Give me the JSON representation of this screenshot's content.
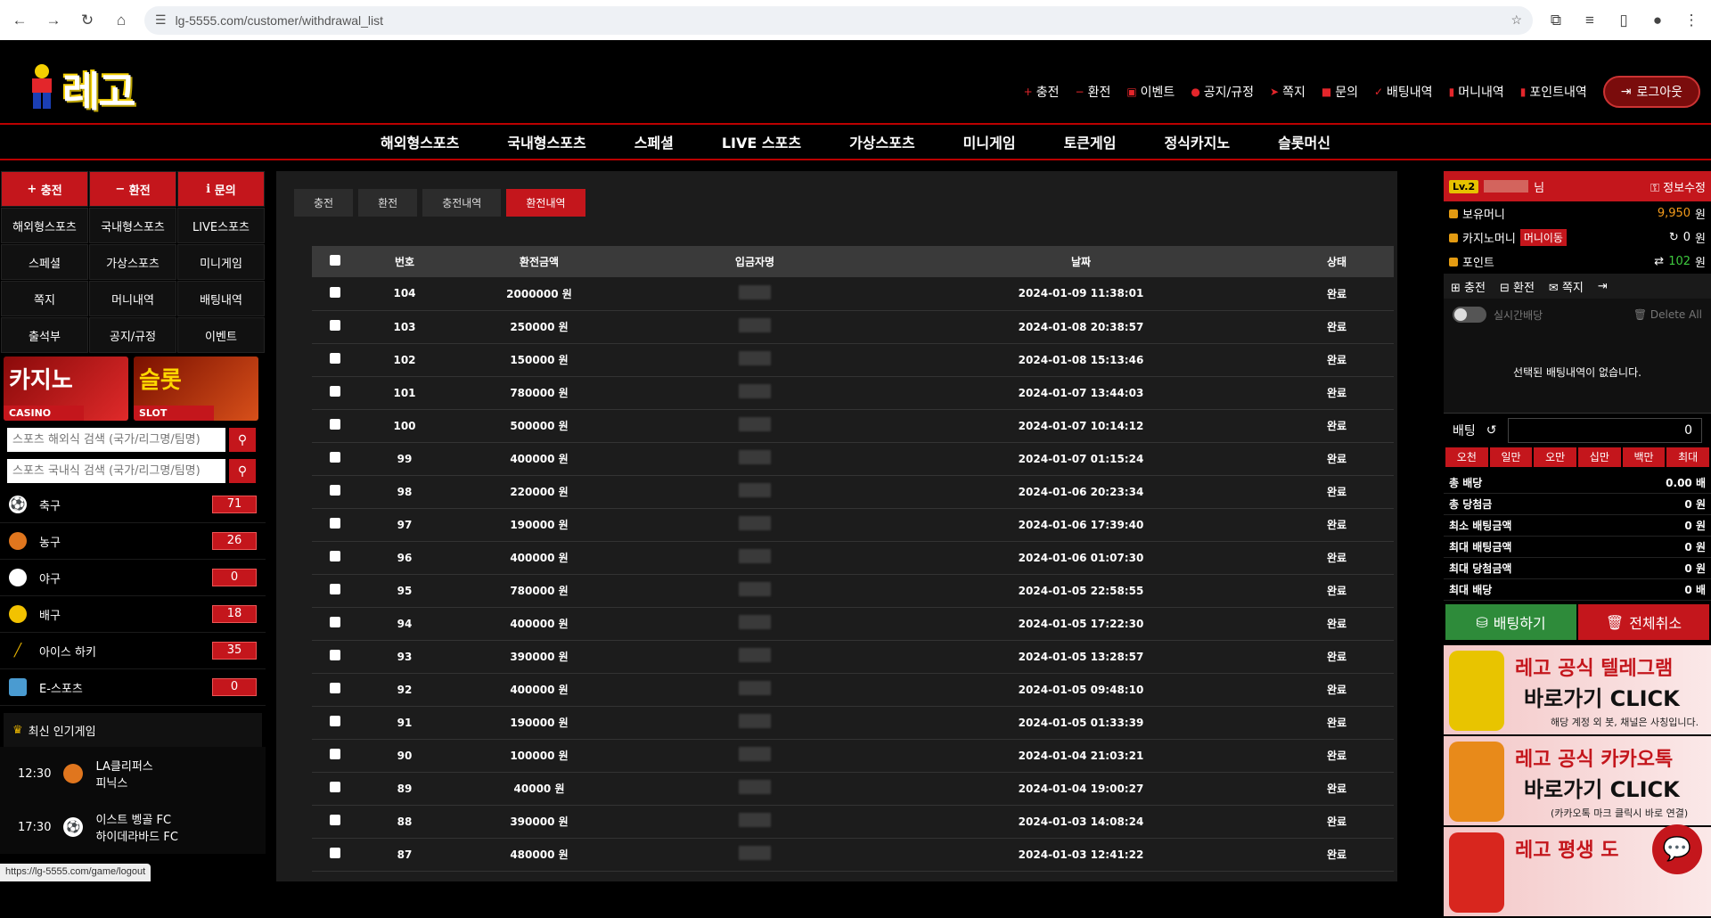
{
  "browser": {
    "url": "lg-5555.com/customer/withdrawal_list"
  },
  "header": {
    "logo_text": "레고",
    "nav": [
      "충전",
      "환전",
      "이벤트",
      "공지/규정",
      "쪽지",
      "문의",
      "배팅내역",
      "머니내역",
      "포인트내역"
    ],
    "logout": "로그아웃"
  },
  "mainnav": [
    "해외형스포츠",
    "국내형스포츠",
    "스페셜",
    "LIVE 스포츠",
    "가상스포츠",
    "미니게임",
    "토큰게임",
    "정식카지노",
    "슬롯머신"
  ],
  "left": {
    "quick": [
      "충전",
      "환전",
      "문의",
      "해외형스포츠",
      "국내형스포츠",
      "LIVE스포츠",
      "스페셜",
      "가상스포츠",
      "미니게임",
      "쪽지",
      "머니내역",
      "배팅내역",
      "출석부",
      "공지/규정",
      "이벤트"
    ],
    "banner_casino": {
      "title": "카지노",
      "en": "CASINO"
    },
    "banner_slot": {
      "title": "슬롯",
      "en": "SLOT"
    },
    "search1": "스포츠 해외식 검색 (국가/리그명/팀명)",
    "search2": "스포츠 국내식 검색 (국가/리그명/팀명)",
    "sports": [
      {
        "name": "축구",
        "count": "71"
      },
      {
        "name": "농구",
        "count": "26"
      },
      {
        "name": "야구",
        "count": "0"
      },
      {
        "name": "배구",
        "count": "18"
      },
      {
        "name": "아이스 하키",
        "count": "35"
      },
      {
        "name": "E-스포츠",
        "count": "0"
      }
    ],
    "popular_title": "최신 인기게임",
    "games": [
      {
        "time": "12:30",
        "team1": "LA클리퍼스",
        "team2": "피닉스"
      },
      {
        "time": "17:30",
        "team1": "이스트 벵골 FC",
        "team2": "하이데라바드 FC"
      }
    ]
  },
  "tabs": [
    "충전",
    "환전",
    "충전내역",
    "환전내역"
  ],
  "table": {
    "headers": [
      "번호",
      "환전금액",
      "입금자명",
      "날짜",
      "상태"
    ],
    "rows": [
      [
        "104",
        "2000000 원",
        "2024-01-09 11:38:01",
        "완료"
      ],
      [
        "103",
        "250000 원",
        "2024-01-08 20:38:57",
        "완료"
      ],
      [
        "102",
        "150000 원",
        "2024-01-08 15:13:46",
        "완료"
      ],
      [
        "101",
        "780000 원",
        "2024-01-07 13:44:03",
        "완료"
      ],
      [
        "100",
        "500000 원",
        "2024-01-07 10:14:12",
        "완료"
      ],
      [
        "99",
        "400000 원",
        "2024-01-07 01:15:24",
        "완료"
      ],
      [
        "98",
        "220000 원",
        "2024-01-06 20:23:34",
        "완료"
      ],
      [
        "97",
        "190000 원",
        "2024-01-06 17:39:40",
        "완료"
      ],
      [
        "96",
        "400000 원",
        "2024-01-06 01:07:30",
        "완료"
      ],
      [
        "95",
        "780000 원",
        "2024-01-05 22:58:55",
        "완료"
      ],
      [
        "94",
        "400000 원",
        "2024-01-05 17:22:30",
        "완료"
      ],
      [
        "93",
        "390000 원",
        "2024-01-05 13:28:57",
        "완료"
      ],
      [
        "92",
        "400000 원",
        "2024-01-05 09:48:10",
        "완료"
      ],
      [
        "91",
        "190000 원",
        "2024-01-05 01:33:39",
        "완료"
      ],
      [
        "90",
        "100000 원",
        "2024-01-04 21:03:21",
        "완료"
      ],
      [
        "89",
        "40000 원",
        "2024-01-04 19:00:27",
        "완료"
      ],
      [
        "88",
        "390000 원",
        "2024-01-03 14:08:24",
        "완료"
      ],
      [
        "87",
        "480000 원",
        "2024-01-03 12:41:22",
        "완료"
      ]
    ]
  },
  "right": {
    "level": "Lv.2",
    "suffix": "님",
    "edit": "정보수정",
    "money_label": "보유머니",
    "money": "9,950",
    "won": "원",
    "casino_label": "카지노머니",
    "casino_btn": "머니이동",
    "casino": "0",
    "point_label": "포인트",
    "point": "102",
    "mini": [
      "충전",
      "환전",
      "쪽지"
    ],
    "realtime": "실시간배당",
    "delete_all": "Delete All",
    "empty": "선택된 배팅내역이 없습니다.",
    "bet_label": "배팅",
    "bet_value": "0",
    "amounts": [
      "오천",
      "일만",
      "오만",
      "십만",
      "백만",
      "최대"
    ],
    "stats": [
      {
        "label": "총 배당",
        "value": "0.00 배"
      },
      {
        "label": "총 당첨금",
        "value": "0 원"
      },
      {
        "label": "최소 배팅금액",
        "value": "0 원"
      },
      {
        "label": "최대 배팅금액",
        "value": "0 원"
      },
      {
        "label": "최대 당첨금액",
        "value": "0 원"
      },
      {
        "label": "최대 배당",
        "value": "0 배"
      }
    ],
    "bet_btn": "배팅하기",
    "cancel_btn": "전체취소",
    "promo1": {
      "title": "레고 공식 텔레그램",
      "click": "바로가기 CLICK",
      "sub": "해당 계정 외 봇, 채널은 사칭입니다."
    },
    "promo2": {
      "title": "레고 공식 카카오톡",
      "click": "바로가기 CLICK",
      "sub": "(카카오톡 마크 클릭시 바로 연결)"
    },
    "promo3": {
      "title": "레고 평생 도"
    }
  },
  "status_url": "https://lg-5555.com/game/logout"
}
